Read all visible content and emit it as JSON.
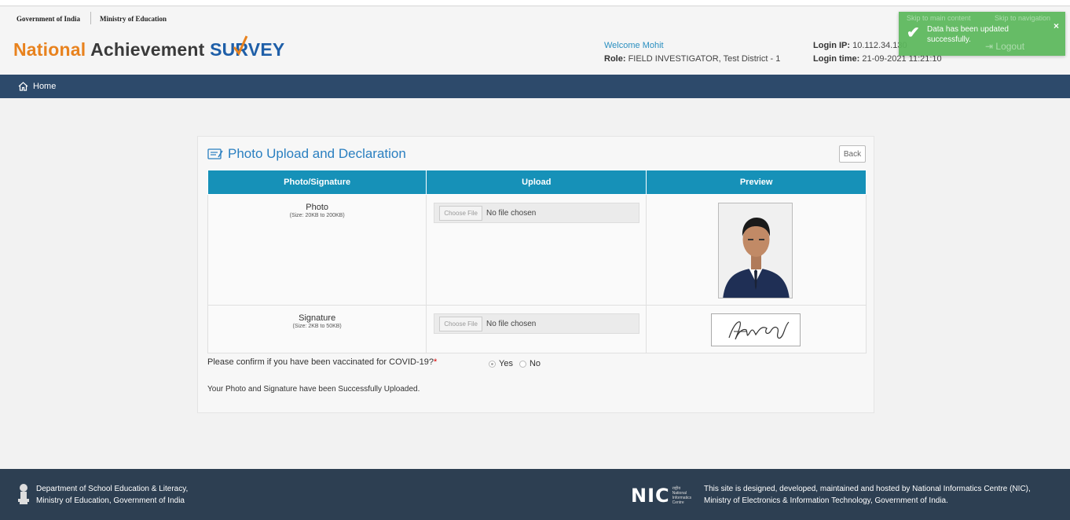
{
  "gov_bar": {
    "gov": "Government of India",
    "ministry": "Ministry of Education"
  },
  "logo": {
    "part1": "National",
    "part2": "Achievement",
    "part3": "SURVEY"
  },
  "user": {
    "welcome": "Welcome Mohit",
    "role_label": "Role:",
    "role_value": "FIELD INVESTIGATOR, Test District - 1",
    "ip_label": "Login IP:",
    "ip_value": "10.112.34.130",
    "time_label": "Login time:",
    "time_value": "21-09-2021 11:21:10"
  },
  "header_links": {
    "skip_main": "Skip to main content",
    "skip_nav": "Skip to navigation",
    "logout": "Logout"
  },
  "toast": {
    "message": "Data has been updated successfully.",
    "close": "×"
  },
  "nav": {
    "home": "Home"
  },
  "panel": {
    "title": "Photo Upload and Declaration",
    "back": "Back",
    "columns": [
      "Photo/Signature",
      "Upload",
      "Preview"
    ],
    "rows": [
      {
        "label": "Photo",
        "size": "(Size: 20KB to 200KB)",
        "choose": "Choose File",
        "status": "No file chosen"
      },
      {
        "label": "Signature",
        "size": "(Size: 2KB to 50KB)",
        "choose": "Choose File",
        "status": "No file chosen"
      }
    ],
    "covid_question": "Please confirm if you have been vaccinated for COVID-19?",
    "covid_required": "*",
    "covid_options": [
      "Yes",
      "No"
    ],
    "covid_selected": "Yes",
    "success_text": "Your Photo and Signature have been Successfully Uploaded."
  },
  "footer": {
    "left_line1": "Department of School Education & Literacy,",
    "left_line2": "Ministry of Education, Government of India",
    "nic_logo": "NIC",
    "nic_small": "राष्ट्रीय National Informatics Centre",
    "right_line1": "This site is designed, developed, maintained and hosted by National Informatics Centre (NIC),",
    "right_line2": "Ministry of Electronics & Information Technology, Government of India."
  },
  "colors": {
    "nav_bg": "#2d4a6b",
    "table_header": "#1691b8",
    "toast": "#5cb85c",
    "logo_orange": "#e8821e",
    "logo_blue": "#1f5fa8",
    "footer_bg": "#2d3f52"
  }
}
